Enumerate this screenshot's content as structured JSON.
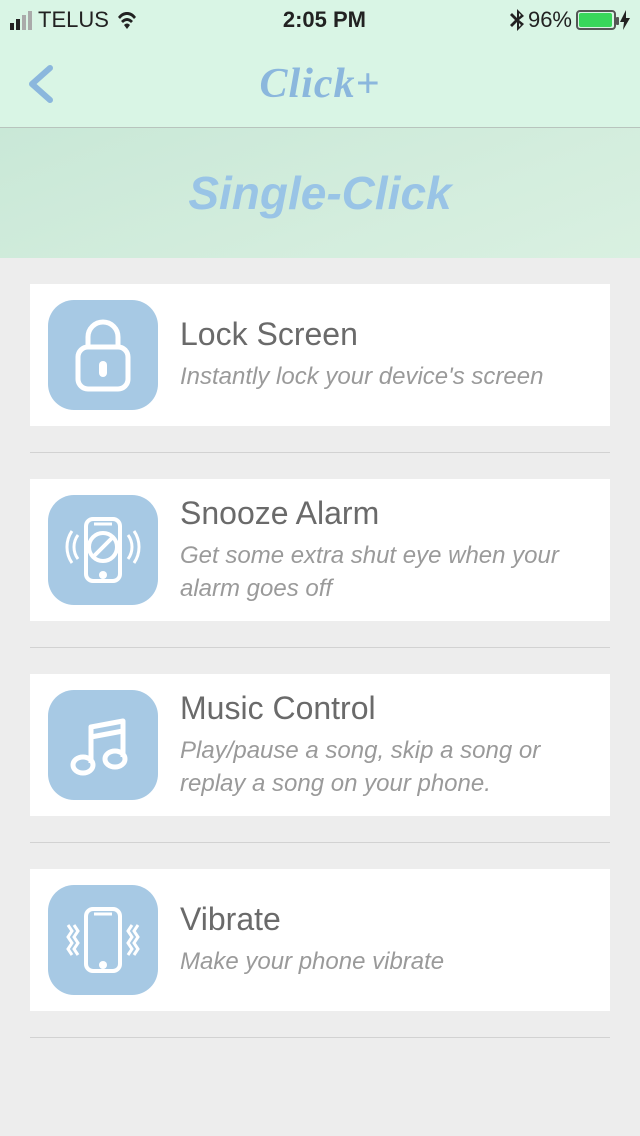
{
  "status": {
    "carrier": "TELUS",
    "time": "2:05 PM",
    "battery_pct": "96%"
  },
  "header": {
    "app_title": "Click+"
  },
  "subheader": {
    "title": "Single-Click"
  },
  "options": [
    {
      "title": "Lock Screen",
      "desc": "Instantly lock your device's screen"
    },
    {
      "title": "Snooze Alarm",
      "desc": "Get some extra shut eye when your alarm goes off"
    },
    {
      "title": "Music Control",
      "desc": "Play/pause a song, skip a song or replay a song on your phone."
    },
    {
      "title": "Vibrate",
      "desc": "Make your phone vibrate"
    }
  ]
}
